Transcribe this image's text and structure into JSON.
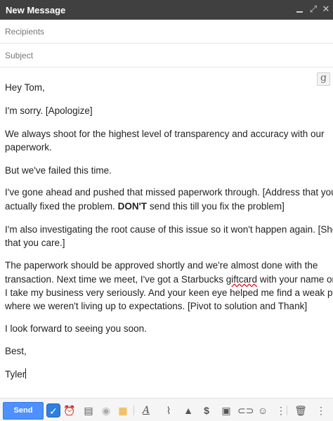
{
  "window": {
    "title": "New Message",
    "controls": [
      "minimize-icon",
      "expand-icon",
      "close-icon"
    ]
  },
  "compose": {
    "recipients_placeholder": "Recipients",
    "subject_placeholder": "Subject",
    "g_button": "g"
  },
  "message": {
    "greeting": "Hey Tom,",
    "sorry": "I'm sorry. [Apologize]",
    "p1_line1": "We always shoot for the highest level of transparency and accuracy with our",
    "p1_line2": "paperwork.",
    "failed": "But we've failed this time.",
    "p2_line1": "I've gone ahead and pushed that missed paperwork through. [Address that you've",
    "p2_line2a": "actually fixed the problem. ",
    "p2_line2b": "DON'T",
    "p2_line2c": " send this till you fix the problem]",
    "p3_line1": "I'm also investigating the root cause of this issue so it won't happen again. [Show",
    "p3_line2": "that you care.]",
    "p4_line1": "The paperwork should be approved shortly and we're almost done with the",
    "p4_line2a": "transaction. Next time we meet, I've got a Starbucks ",
    "p4_line2b": "giftcard",
    "p4_line2c": " with your name on it.",
    "p4_line3": "I take my business very seriously. And your keen eye helped me find a weak point",
    "p4_line4": "where we weren't living up to expectations. [Pivot to solution and Thank]",
    "closing": "I look forward to seeing you soon.",
    "signoff": "Best,",
    "signature": "Tyler"
  },
  "toolbar": {
    "send_label": "Send",
    "icons": [
      "schedule-check-icon",
      "alarm-clock-icon",
      "template-icon",
      "tracking-eye-icon",
      "notes-icon",
      "formatting-icon",
      "attach-icon",
      "drive-icon",
      "money-icon",
      "photo-icon",
      "link-icon",
      "emoji-icon",
      "more-options-icon",
      "trash-icon",
      "more-options-icon"
    ],
    "accent_color": "#4d90fe"
  }
}
